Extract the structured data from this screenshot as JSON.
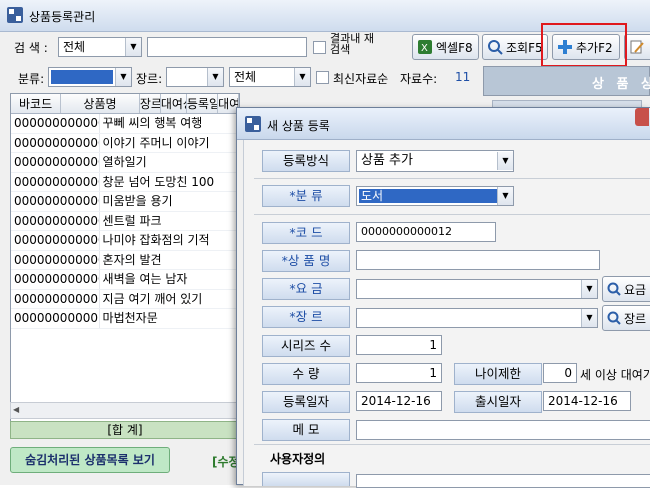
{
  "window": {
    "title": "상품등록관리"
  },
  "search": {
    "label": "검 색 :",
    "scope_value": "전체",
    "query_value": "",
    "research_label": "결과내 재검색"
  },
  "toolbar": {
    "excel_label": "엑셀F8",
    "query_label": "조회F5",
    "add_label": "추가F2",
    "edit_label": ""
  },
  "filter": {
    "category_label": "분류:",
    "category_value": "",
    "genre_label": "장르:",
    "genre_value": "",
    "status_value": "전체",
    "recent_label": "최신자료순",
    "count_label": "자료수:",
    "count_value": "11"
  },
  "grid": {
    "columns": [
      "바코드",
      "상품명",
      "장르",
      "대여상태",
      "등록일자",
      "대여"
    ],
    "rows": [
      [
        "0000000000001",
        "꾸뻬 씨의 행복 여행"
      ],
      [
        "0000000000002",
        "이야기 주머니 이야기"
      ],
      [
        "0000000000003",
        "열하일기"
      ],
      [
        "0000000000004",
        "창문 넘어 도망친 100"
      ],
      [
        "0000000000005",
        "미움받을 용기"
      ],
      [
        "0000000000006",
        "센트럴 파크"
      ],
      [
        "0000000000007",
        "나미야 잡화점의 기적"
      ],
      [
        "0000000000008",
        "혼자의 발견"
      ],
      [
        "0000000000009",
        "새벽을 여는 남자"
      ],
      [
        "0000000000010",
        "지금 여기 깨어 있기"
      ],
      [
        "0000000000011",
        "마법천자문"
      ]
    ],
    "sum_label": "[합 계]"
  },
  "bottom": {
    "hidden_list_label": "숨김처리된 상품목록 보기",
    "edit_hint": "[수정"
  },
  "right_panel": {
    "title": "상 품 상"
  },
  "dialog": {
    "title": "새 상품 등록",
    "reg_method_label": "등록방식",
    "reg_method_value": "상품 추가",
    "category_label": "*분   류",
    "category_value": "도서",
    "code_label": "*코   드",
    "code_value": "0000000000012",
    "name_label": "*상 품 명",
    "name_value": "",
    "fee_label": "*요   금",
    "fee_value": "",
    "fee_button": "요금",
    "genre_label": "*장   르",
    "genre_value": "",
    "genre_button": "장르",
    "series_label": "시리즈 수",
    "series_value": "1",
    "quantity_label": "수   량",
    "quantity_value": "1",
    "age_label": "나이제한",
    "age_value": "0",
    "age_suffix": "세 이상 대여가",
    "reg_date_label": "등록일자",
    "reg_date_value": "2014-12-16",
    "release_label": "출시일자",
    "release_value": "2014-12-16",
    "memo_label": "메   모",
    "memo_value": "",
    "custom_section": "사용자정의"
  }
}
